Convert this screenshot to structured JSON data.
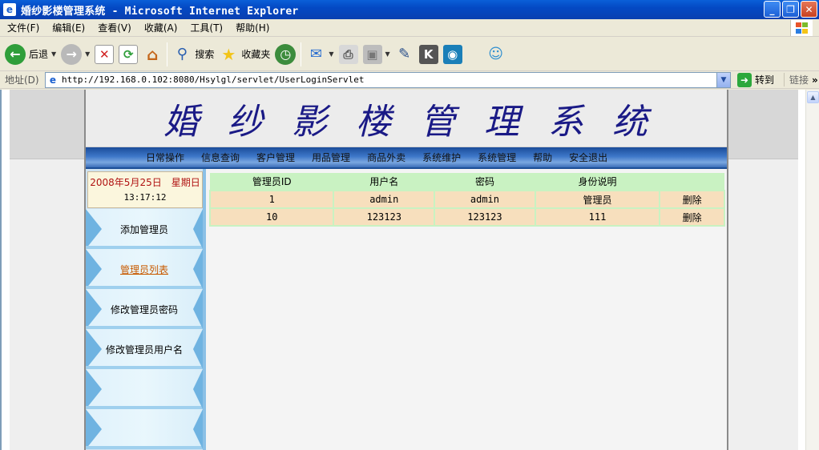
{
  "window": {
    "title": "婚纱影楼管理系统 - Microsoft Internet Explorer"
  },
  "menu": [
    "文件(F)",
    "编辑(E)",
    "查看(V)",
    "收藏(A)",
    "工具(T)",
    "帮助(H)"
  ],
  "toolbar": {
    "back": "后退",
    "search": "搜索",
    "favorites": "收藏夹"
  },
  "address": {
    "label": "地址(D)",
    "url": "http://192.168.0.102:8080/Hsylgl/servlet/UserLoginServlet",
    "go": "转到",
    "links": "链接"
  },
  "site": {
    "title": "婚纱影楼管理系统",
    "nav": [
      "日常操作",
      "信息查询",
      "客户管理",
      "用品管理",
      "商品外卖",
      "系统维护",
      "系统管理",
      "帮助",
      "安全退出"
    ]
  },
  "sidebar": {
    "date": "2008年5月25日　星期日",
    "time": "13:17:12",
    "items": [
      {
        "label": "添加管理员",
        "active": false
      },
      {
        "label": "管理员列表",
        "active": true
      },
      {
        "label": "修改管理员密码",
        "active": false
      },
      {
        "label": "修改管理员用户名",
        "active": false
      },
      {
        "label": "",
        "active": false
      },
      {
        "label": "",
        "active": false
      }
    ]
  },
  "table": {
    "headers": [
      "管理员ID",
      "用户名",
      "密码",
      "身份说明",
      ""
    ],
    "rows": [
      {
        "id": "1",
        "username": "admin",
        "password": "admin",
        "role": "管理员",
        "action": "删除"
      },
      {
        "id": "10",
        "username": "123123",
        "password": "123123",
        "role": "111",
        "action": "删除"
      }
    ]
  },
  "colors": {
    "title_blue": "#1a1a86",
    "nav_blue": "#3d77c8",
    "header_green": "#c9f2c2",
    "row_peach": "#f7dfbd",
    "active_link": "#c85a00"
  }
}
